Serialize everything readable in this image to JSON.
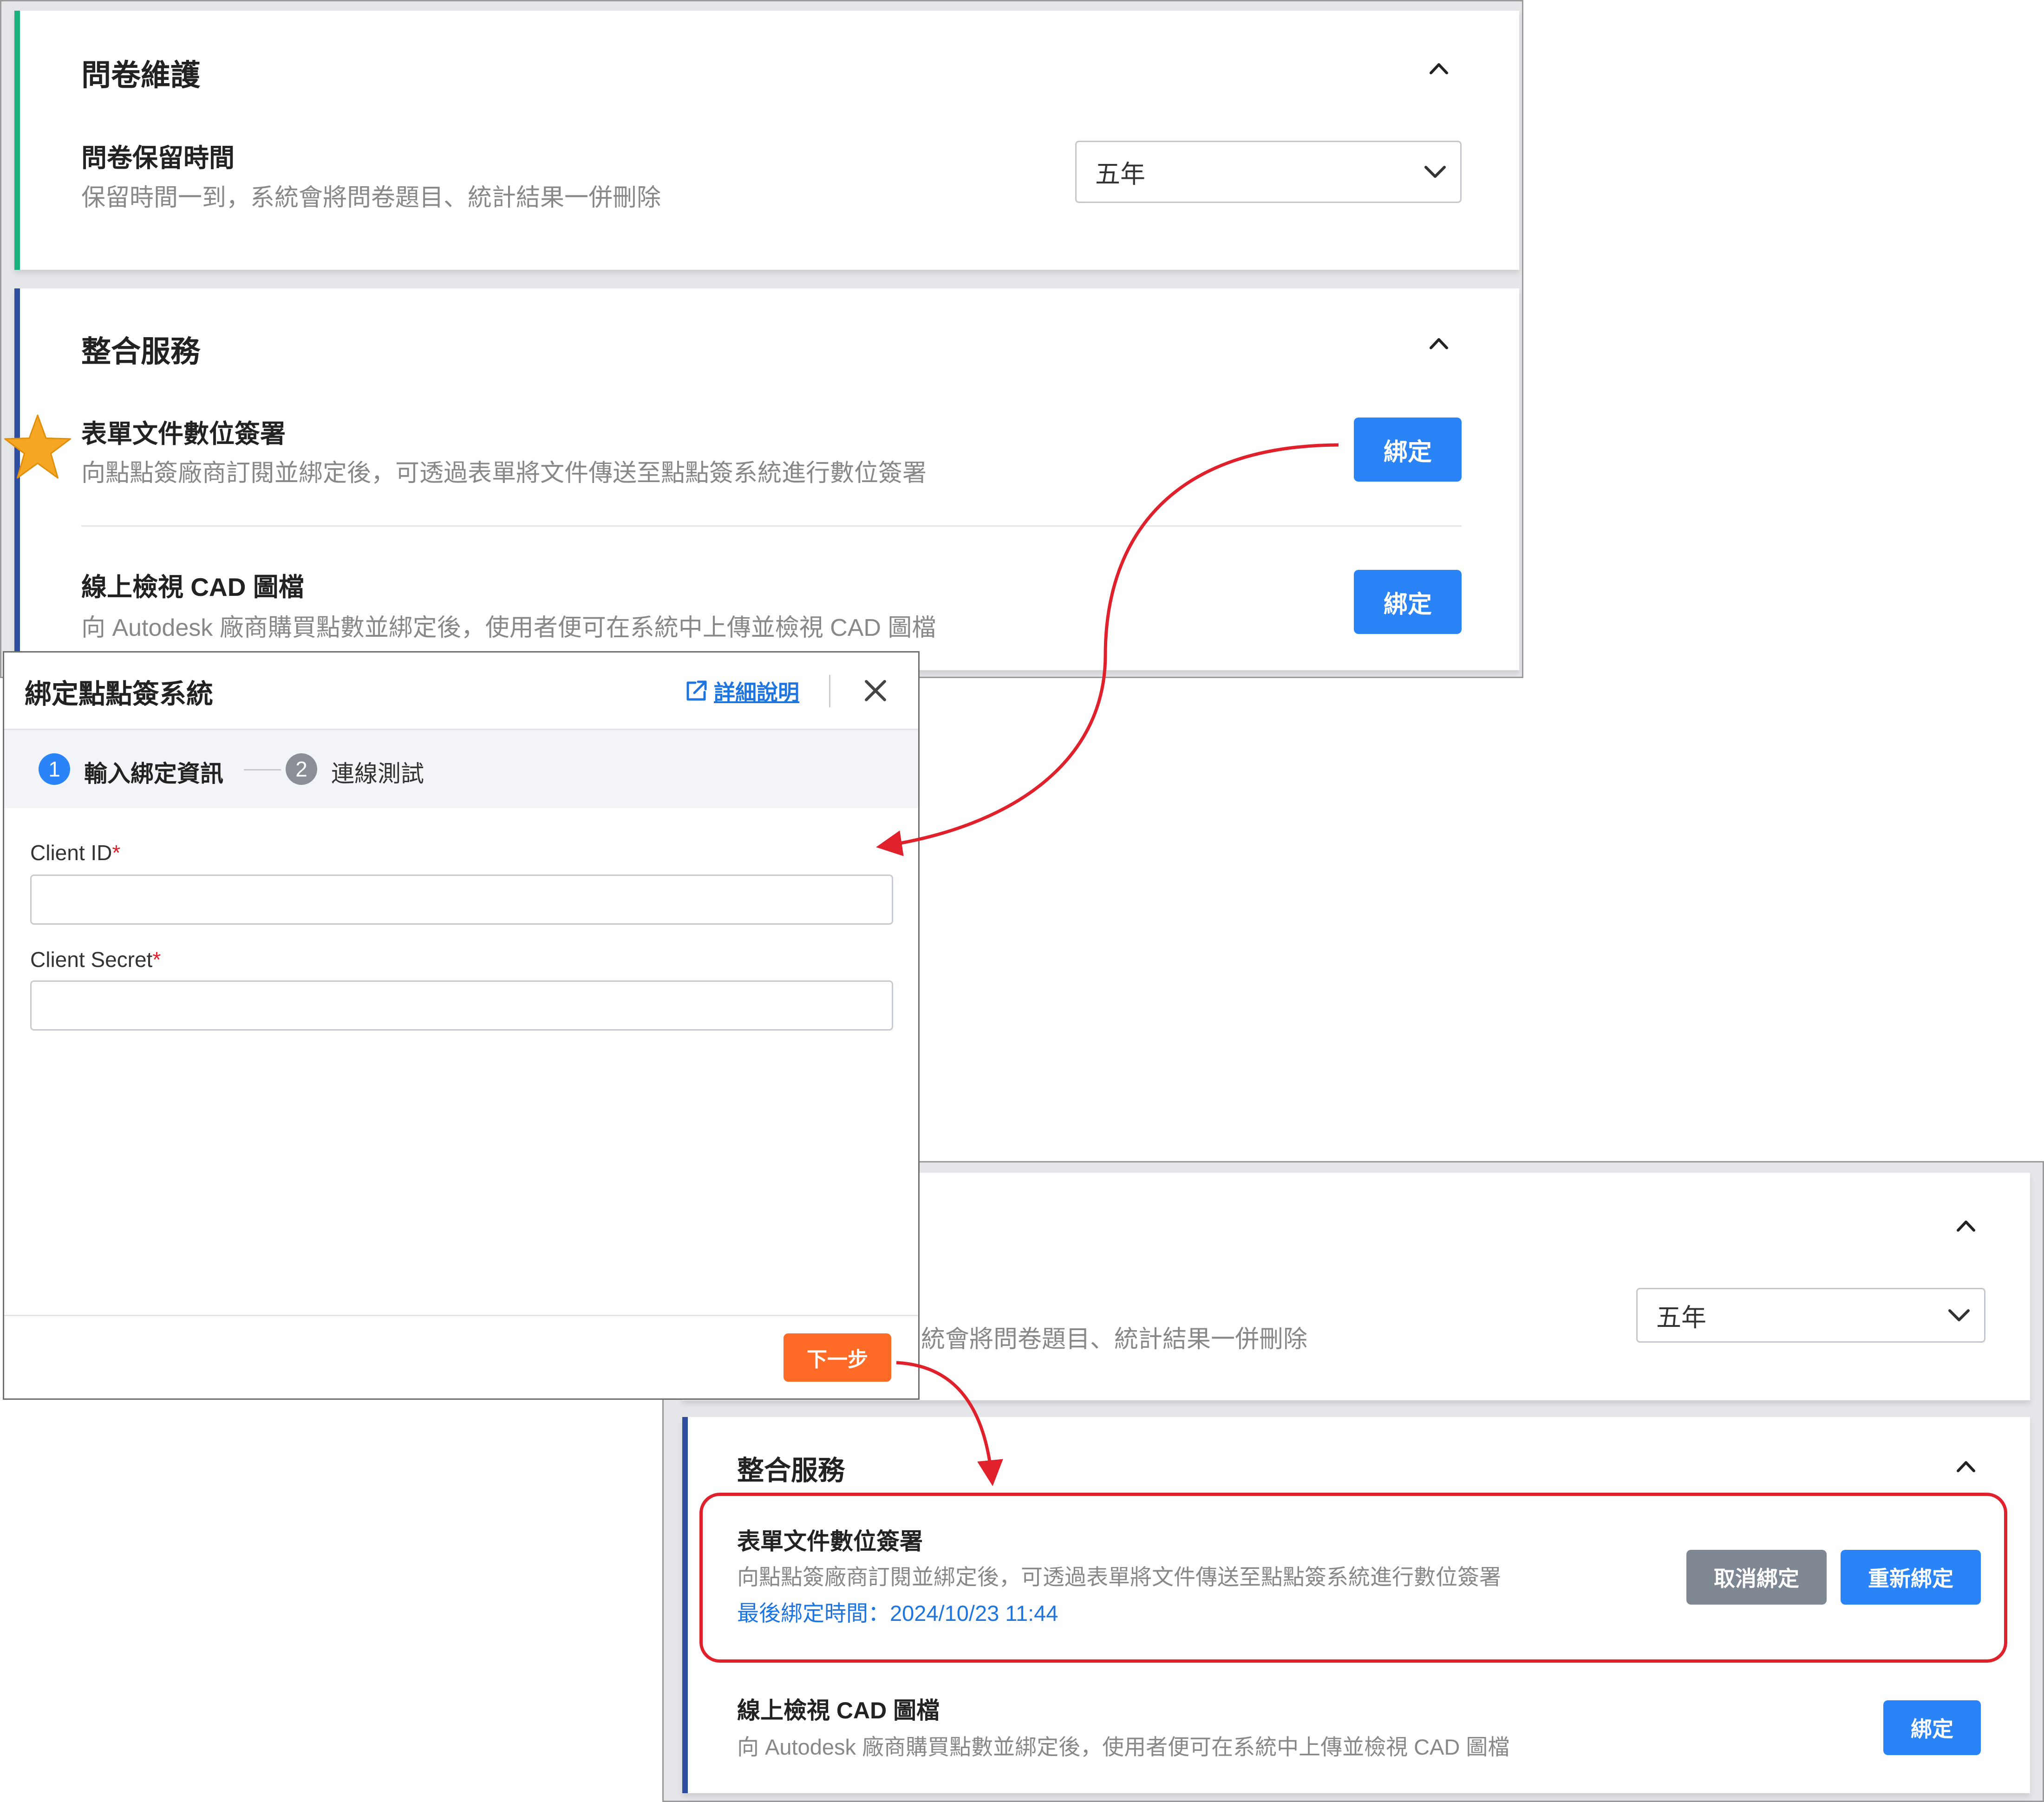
{
  "colors": {
    "accent_green": "#19b17b",
    "accent_blue": "#2c4da0",
    "primary_button": "#2a83f7",
    "secondary_button": "#7f8792",
    "next_button": "#ff6a26",
    "annotation_red": "#e0202a",
    "star": "#f5a623",
    "link": "#1e75e0"
  },
  "top_panel": {
    "survey_section": {
      "title": "問卷維護",
      "retention_label": "問卷保留時間",
      "retention_desc": "保留時間一到，系統會將問卷題目、統計結果一併刪除",
      "retention_value": "五年"
    },
    "integration_section": {
      "title": "整合服務",
      "items": [
        {
          "label": "表單文件數位簽署",
          "desc": "向點點簽廠商訂閱並綁定後，可透過表單將文件傳送至點點簽系統進行數位簽署",
          "button": "綁定",
          "star_icon": "star-icon"
        },
        {
          "label": "線上檢視 CAD 圖檔",
          "desc": "向 Autodesk 廠商購買點數並綁定後，使用者便可在系統中上傳並檢視 CAD 圖檔",
          "button": "綁定"
        }
      ]
    }
  },
  "dialog": {
    "title": "綁定點點簽系統",
    "help_link": "詳細說明",
    "steps": [
      {
        "num": "1",
        "label": "輸入綁定資訊"
      },
      {
        "num": "2",
        "label": "連線測試"
      }
    ],
    "fields": [
      {
        "label": "Client ID",
        "required_mark": "*",
        "value": ""
      },
      {
        "label": "Client Secret",
        "required_mark": "*",
        "value": ""
      }
    ],
    "next_button": "下一步"
  },
  "bottom_panel": {
    "retention_desc_partial": "統會將問卷題目、統計結果一併刪除",
    "retention_value": "五年",
    "integration_section": {
      "title": "整合服務",
      "items": [
        {
          "label": "表單文件數位簽署",
          "desc": "向點點簽廠商訂閱並綁定後，可透過表單將文件傳送至點點簽系統進行數位簽署",
          "last_bound": "最後綁定時間：2024/10/23 11:44",
          "unbind_button": "取消綁定",
          "rebind_button": "重新綁定"
        },
        {
          "label": "線上檢視 CAD 圖檔",
          "desc": "向 Autodesk 廠商購買點數並綁定後，使用者便可在系統中上傳並檢視 CAD 圖檔",
          "button": "綁定"
        }
      ]
    }
  }
}
